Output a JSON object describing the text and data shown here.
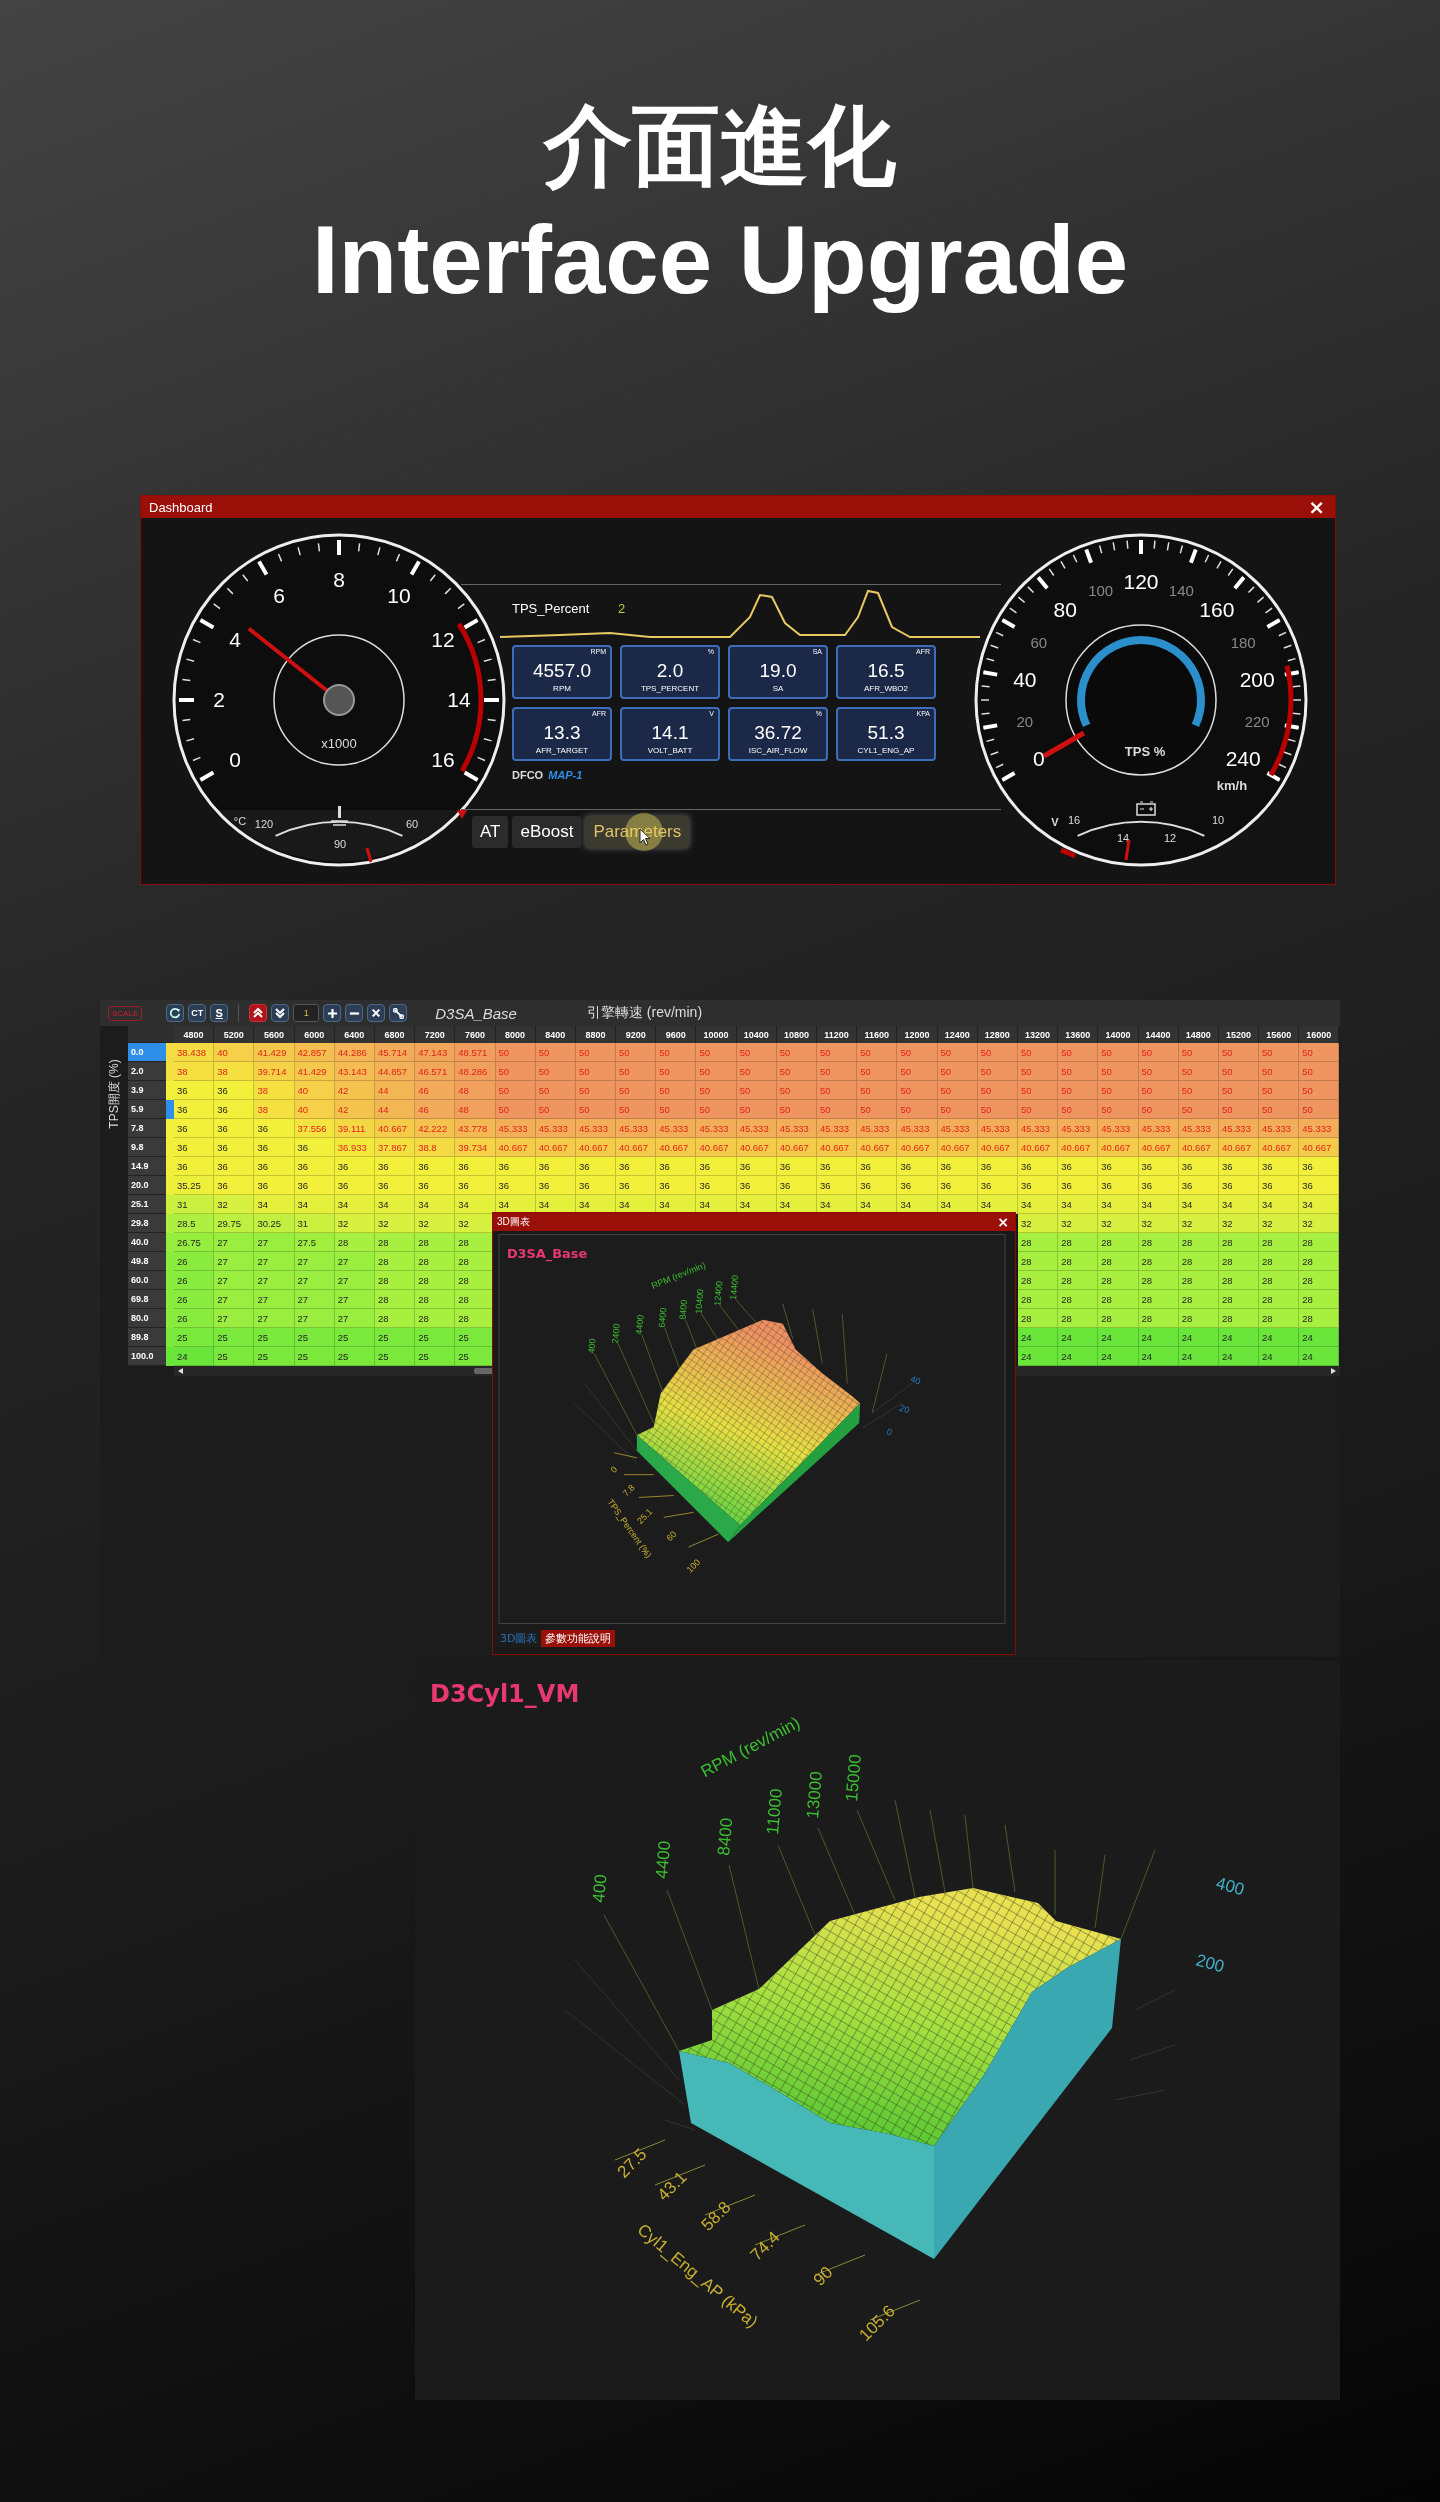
{
  "heading": {
    "title_zh": "介面進化",
    "title_en": "Interface Upgrade"
  },
  "dashboard": {
    "title": "Dashboard",
    "close": "×",
    "tach": {
      "labels": [
        "0",
        "2",
        "4",
        "6",
        "8",
        "10",
        "12",
        "14",
        "16"
      ],
      "unit": "x1000",
      "temp_unit": "°C",
      "temp_labels": [
        "120",
        "90",
        "60"
      ]
    },
    "speedo": {
      "labels": [
        {
          "text": "0",
          "kind": "major"
        },
        {
          "text": "20",
          "kind": "minor"
        },
        {
          "text": "40",
          "kind": "major"
        },
        {
          "text": "60",
          "kind": "minor"
        },
        {
          "text": "80",
          "kind": "major"
        },
        {
          "text": "100",
          "kind": "minor"
        },
        {
          "text": "120",
          "kind": "major"
        },
        {
          "text": "140",
          "kind": "minor"
        },
        {
          "text": "160",
          "kind": "major"
        },
        {
          "text": "180",
          "kind": "minor"
        },
        {
          "text": "200",
          "kind": "major"
        },
        {
          "text": "220",
          "kind": "minor"
        },
        {
          "text": "240",
          "kind": "major"
        }
      ],
      "unit": "km/h",
      "tps_label": "TPS %",
      "volt_unit": "V",
      "volt_labels": [
        "16",
        "14",
        "12",
        "10"
      ]
    },
    "trend": {
      "label": "TPS_Percent",
      "value": "2"
    },
    "tiles": [
      {
        "value": "4557.0",
        "unit": "RPM",
        "label": "RPM"
      },
      {
        "value": "2.0",
        "unit": "%",
        "label": "TPS_PERCENT"
      },
      {
        "value": "19.0",
        "unit": "SA",
        "label": "SA"
      },
      {
        "value": "16.5",
        "unit": "AFR",
        "label": "AFR_WBO2"
      },
      {
        "value": "13.3",
        "unit": "AFR",
        "label": "AFR_TARGET"
      },
      {
        "value": "14.1",
        "unit": "V",
        "label": "VOLT_BATT"
      },
      {
        "value": "36.72",
        "unit": "%",
        "label": "ISC_AIR_FLOW"
      },
      {
        "value": "51.3",
        "unit": "KPA",
        "label": "CYL1_ENG_AP"
      }
    ],
    "mode": "DFCO",
    "map": "MAP-1",
    "tabs": [
      {
        "label": "AT",
        "selected": false
      },
      {
        "label": "eBoost",
        "selected": false
      },
      {
        "label": "Parameters",
        "selected": true
      }
    ]
  },
  "table": {
    "scale": "SCALE",
    "ct": "CT",
    "s": "S",
    "step": "1",
    "title": "D3SA_Base",
    "x_axis": "引擎轉速 (rev/min)",
    "y_axis": "TPS開度 (%)",
    "columns": [
      "4800",
      "5200",
      "5600",
      "6000",
      "6400",
      "6800",
      "7200",
      "7600",
      "8000",
      "8400",
      "8800",
      "9200",
      "9600",
      "10000",
      "10400",
      "10800",
      "11200",
      "11600",
      "12000",
      "12400",
      "12800",
      "13200",
      "13600",
      "14000",
      "14400",
      "14800",
      "15200",
      "15600",
      "16000"
    ],
    "rows": [
      {
        "label": "0.0",
        "selected": true,
        "marker": false,
        "cells": [
          "38.438",
          "40",
          "41.429",
          "42.857",
          "44.286",
          "45.714",
          "47.143",
          "48.571",
          "50",
          "50",
          "50",
          "50",
          "50",
          "50",
          "50",
          "50",
          "50",
          "50",
          "50",
          "50",
          "50",
          "50",
          "50",
          "50",
          "50",
          "50",
          "50",
          "50",
          "50"
        ]
      },
      {
        "label": "2.0",
        "selected": false,
        "marker": false,
        "cells": [
          "38",
          "38",
          "39.714",
          "41.429",
          "43.143",
          "44.857",
          "46.571",
          "48.286",
          "50",
          "50",
          "50",
          "50",
          "50",
          "50",
          "50",
          "50",
          "50",
          "50",
          "50",
          "50",
          "50",
          "50",
          "50",
          "50",
          "50",
          "50",
          "50",
          "50",
          "50"
        ]
      },
      {
        "label": "3.9",
        "selected": false,
        "marker": false,
        "cells": [
          "36",
          "36",
          "38",
          "40",
          "42",
          "44",
          "46",
          "48",
          "50",
          "50",
          "50",
          "50",
          "50",
          "50",
          "50",
          "50",
          "50",
          "50",
          "50",
          "50",
          "50",
          "50",
          "50",
          "50",
          "50",
          "50",
          "50",
          "50",
          "50"
        ]
      },
      {
        "label": "5.9",
        "selected": false,
        "marker": true,
        "cells": [
          "36",
          "36",
          "38",
          "40",
          "42",
          "44",
          "46",
          "48",
          "50",
          "50",
          "50",
          "50",
          "50",
          "50",
          "50",
          "50",
          "50",
          "50",
          "50",
          "50",
          "50",
          "50",
          "50",
          "50",
          "50",
          "50",
          "50",
          "50",
          "50"
        ]
      },
      {
        "label": "7.8",
        "selected": false,
        "marker": false,
        "cells": [
          "36",
          "36",
          "36",
          "37.556",
          "39.111",
          "40.667",
          "42.222",
          "43.778",
          "45.333",
          "45.333",
          "45.333",
          "45.333",
          "45.333",
          "45.333",
          "45.333",
          "45.333",
          "45.333",
          "45.333",
          "45.333",
          "45.333",
          "45.333",
          "45.333",
          "45.333",
          "45.333",
          "45.333",
          "45.333",
          "45.333",
          "45.333",
          "45.333"
        ]
      },
      {
        "label": "9.8",
        "selected": false,
        "marker": false,
        "cells": [
          "36",
          "36",
          "36",
          "36",
          "36.933",
          "37.867",
          "38.8",
          "39.734",
          "40.667",
          "40.667",
          "40.667",
          "40.667",
          "40.667",
          "40.667",
          "40.667",
          "40.667",
          "40.667",
          "40.667",
          "40.667",
          "40.667",
          "40.667",
          "40.667",
          "40.667",
          "40.667",
          "40.667",
          "40.667",
          "40.667",
          "40.667",
          "40.667"
        ]
      },
      {
        "label": "14.9",
        "selected": false,
        "marker": false,
        "cells": [
          "36",
          "36",
          "36",
          "36",
          "36",
          "36",
          "36",
          "36",
          "36",
          "36",
          "36",
          "36",
          "36",
          "36",
          "36",
          "36",
          "36",
          "36",
          "36",
          "36",
          "36",
          "36",
          "36",
          "36",
          "36",
          "36",
          "36",
          "36",
          "36"
        ]
      },
      {
        "label": "20.0",
        "selected": false,
        "marker": false,
        "cells": [
          "35.25",
          "36",
          "36",
          "36",
          "36",
          "36",
          "36",
          "36",
          "36",
          "36",
          "36",
          "36",
          "36",
          "36",
          "36",
          "36",
          "36",
          "36",
          "36",
          "36",
          "36",
          "36",
          "36",
          "36",
          "36",
          "36",
          "36",
          "36",
          "36"
        ]
      },
      {
        "label": "25.1",
        "selected": false,
        "marker": false,
        "cells": [
          "31",
          "32",
          "34",
          "34",
          "34",
          "34",
          "34",
          "34",
          "34",
          "34",
          "34",
          "34",
          "34",
          "34",
          "34",
          "34",
          "34",
          "34",
          "34",
          "34",
          "34",
          "34",
          "34",
          "34",
          "34",
          "34",
          "34",
          "34",
          "34"
        ]
      },
      {
        "label": "29.8",
        "selected": false,
        "marker": false,
        "cells": [
          "28.5",
          "29.75",
          "30.25",
          "31",
          "32",
          "32",
          "32",
          "32",
          null,
          null,
          null,
          null,
          null,
          null,
          null,
          null,
          null,
          null,
          null,
          null,
          null,
          "32",
          "32",
          "32",
          "32",
          "32",
          "32",
          "32",
          "32"
        ]
      },
      {
        "label": "40.0",
        "selected": false,
        "marker": false,
        "cells": [
          "26.75",
          "27",
          "27",
          "27.5",
          "28",
          "28",
          "28",
          "28",
          null,
          null,
          null,
          null,
          null,
          null,
          null,
          null,
          null,
          null,
          null,
          null,
          null,
          "28",
          "28",
          "28",
          "28",
          "28",
          "28",
          "28",
          "28"
        ]
      },
      {
        "label": "49.8",
        "selected": false,
        "marker": false,
        "cells": [
          "26",
          "27",
          "27",
          "27",
          "27",
          "28",
          "28",
          "28",
          null,
          null,
          null,
          null,
          null,
          null,
          null,
          null,
          null,
          null,
          null,
          null,
          null,
          "28",
          "28",
          "28",
          "28",
          "28",
          "28",
          "28",
          "28"
        ]
      },
      {
        "label": "60.0",
        "selected": false,
        "marker": false,
        "cells": [
          "26",
          "27",
          "27",
          "27",
          "27",
          "28",
          "28",
          "28",
          null,
          null,
          null,
          null,
          null,
          null,
          null,
          null,
          null,
          null,
          null,
          null,
          null,
          "28",
          "28",
          "28",
          "28",
          "28",
          "28",
          "28",
          "28"
        ]
      },
      {
        "label": "69.8",
        "selected": false,
        "marker": false,
        "cells": [
          "26",
          "27",
          "27",
          "27",
          "27",
          "28",
          "28",
          "28",
          null,
          null,
          null,
          null,
          null,
          null,
          null,
          null,
          null,
          null,
          null,
          null,
          null,
          "28",
          "28",
          "28",
          "28",
          "28",
          "28",
          "28",
          "28"
        ]
      },
      {
        "label": "80.0",
        "selected": false,
        "marker": false,
        "cells": [
          "26",
          "27",
          "27",
          "27",
          "27",
          "28",
          "28",
          "28",
          null,
          null,
          null,
          null,
          null,
          null,
          null,
          null,
          null,
          null,
          null,
          null,
          null,
          "28",
          "28",
          "28",
          "28",
          "28",
          "28",
          "28",
          "28"
        ]
      },
      {
        "label": "89.8",
        "selected": false,
        "marker": false,
        "cells": [
          "25",
          "25",
          "25",
          "25",
          "25",
          "25",
          "25",
          "25",
          null,
          null,
          null,
          null,
          null,
          null,
          null,
          null,
          null,
          null,
          null,
          null,
          null,
          "24",
          "24",
          "24",
          "24",
          "24",
          "24",
          "24",
          "24"
        ]
      },
      {
        "label": "100.0",
        "selected": false,
        "marker": false,
        "cells": [
          "24",
          "25",
          "25",
          "25",
          "25",
          "25",
          "25",
          "25",
          null,
          null,
          null,
          null,
          null,
          null,
          null,
          null,
          null,
          null,
          null,
          null,
          null,
          "24",
          "24",
          "24",
          "24",
          "24",
          "24",
          "24",
          "24"
        ]
      }
    ]
  },
  "popup": {
    "title": "3D圖表",
    "close": "×",
    "chart_title": "D3SA_Base",
    "rpm_label": "RPM (rev/min)",
    "rpm_ticks": [
      "400",
      "2400",
      "4400",
      "6400",
      "8400",
      "10400",
      "12400",
      "14400"
    ],
    "z_ticks": [
      "40",
      "20",
      "0"
    ],
    "tps_ticks": [
      "0",
      "7.8",
      "25.1",
      "60",
      "100"
    ],
    "tps_label": "TPS_Percent (%)",
    "tabs": [
      {
        "label": "3D圖表",
        "selected": true
      },
      {
        "label": "參數功能說明",
        "selected": false
      }
    ]
  },
  "surface": {
    "chart_title": "D3Cyl1_VM",
    "rpm_label": "RPM (rev/min)",
    "rpm_ticks": [
      "400",
      "4400",
      "8400",
      "11000",
      "13000",
      "15000"
    ],
    "z_ticks": [
      "400",
      "200"
    ],
    "ap_ticks": [
      "27.5",
      "43.1",
      "58.8",
      "74.4",
      "90",
      "105.6"
    ],
    "ap_label": "Cyl1_Eng_AP (kPa)"
  }
}
